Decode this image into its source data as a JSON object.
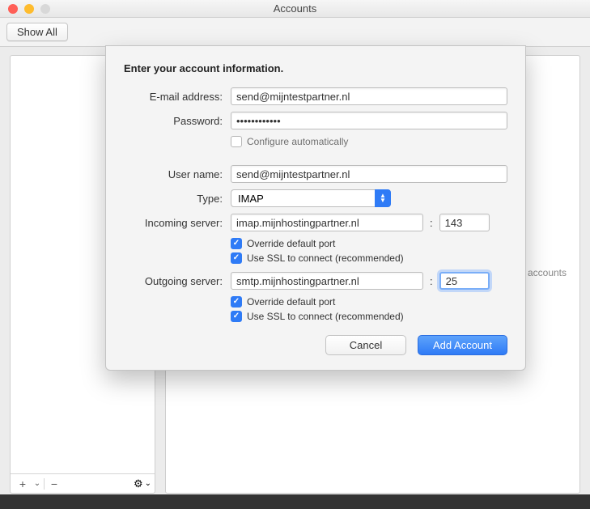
{
  "window": {
    "title": "Accounts",
    "show_all": "Show All"
  },
  "sidebar": {
    "footer": {
      "add": "+",
      "drop": "⌄",
      "remove": "−",
      "gear": "⚙"
    }
  },
  "content": {
    "hint_line1": "t accounts"
  },
  "sheet": {
    "heading": "Enter your account information.",
    "labels": {
      "email": "E-mail address:",
      "password": "Password:",
      "configure_auto": "Configure automatically",
      "username": "User name:",
      "type": "Type:",
      "incoming": "Incoming server:",
      "outgoing": "Outgoing server:",
      "override_port": "Override default port",
      "use_ssl": "Use SSL to connect (recommended)"
    },
    "values": {
      "email": "send@mijntestpartner.nl",
      "password": "••••••••••••",
      "username": "send@mijntestpartner.nl",
      "type_selected": "IMAP",
      "incoming_host": "imap.mijnhostingpartner.nl",
      "incoming_port": "143",
      "outgoing_host": "smtp.mijnhostingpartner.nl",
      "outgoing_port": "25"
    },
    "checks": {
      "configure_auto": false,
      "incoming_override": true,
      "incoming_ssl": true,
      "outgoing_override": true,
      "outgoing_ssl": true
    },
    "buttons": {
      "cancel": "Cancel",
      "add": "Add Account"
    }
  }
}
